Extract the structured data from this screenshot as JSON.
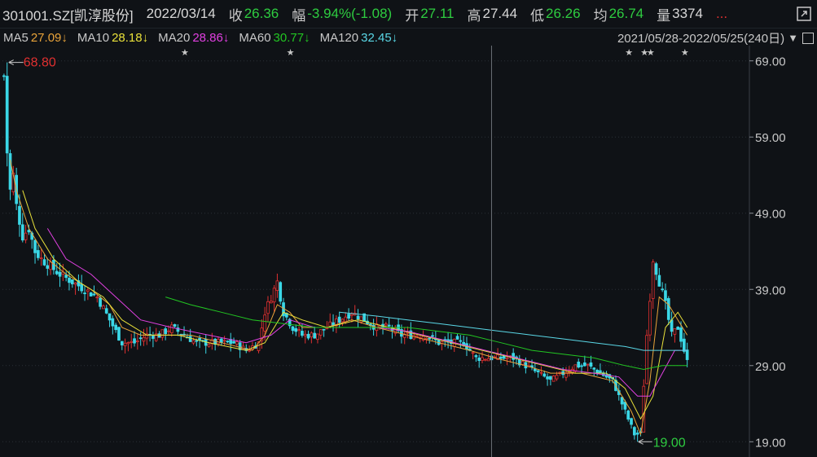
{
  "header": {
    "code": "301001.SZ[凯淳股份]",
    "date": "2022/03/14",
    "close_label": "收",
    "close_value": "26.36",
    "change_label": "幅",
    "change_value": "-3.94%(-1.08)",
    "open_label": "开",
    "open_value": "27.11",
    "high_label": "高",
    "high_value": "27.44",
    "low_label": "低",
    "low_value": "26.26",
    "avg_label": "均",
    "avg_value": "26.74",
    "volume_label": "量",
    "volume_value": "3374",
    "more_label": "..."
  },
  "ma_bar": {
    "items": [
      {
        "label": "MA5",
        "value": "27.09↓",
        "color": "#e8a33a"
      },
      {
        "label": "MA10",
        "value": "28.18↓",
        "color": "#e8e03a"
      },
      {
        "label": "MA20",
        "value": "28.86↓",
        "color": "#e040e0"
      },
      {
        "label": "MA60",
        "value": "30.77↓",
        "color": "#22c522"
      },
      {
        "label": "MA120",
        "value": "32.45↓",
        "color": "#5ad7e6"
      }
    ],
    "range": "2021/05/28-2022/05/25(240日)"
  },
  "colors": {
    "up": "#e03030",
    "down": "#3ad7e6",
    "bg": "#0f1216",
    "grid": "#2a2f36"
  },
  "chart_data": {
    "type": "candlestick",
    "ylim": [
      17,
      71
    ],
    "yticks": [
      "69.00",
      "59.00",
      "49.00",
      "39.00",
      "29.00",
      "19.00"
    ],
    "x_range": "2021/05/28-2022/05/25",
    "n_bars": 240,
    "annotations": {
      "max_label": "68.80",
      "min_label": "19.00"
    },
    "event_markers": 6,
    "cursor_bar": 157,
    "close_path": [
      [
        0,
        67
      ],
      [
        1,
        57
      ],
      [
        2,
        52
      ],
      [
        3,
        54
      ],
      [
        4,
        50
      ],
      [
        6,
        46
      ],
      [
        8,
        47
      ],
      [
        10,
        44
      ],
      [
        12,
        43
      ],
      [
        15,
        42
      ],
      [
        18,
        41
      ],
      [
        22,
        40
      ],
      [
        26,
        39
      ],
      [
        30,
        38
      ],
      [
        34,
        35
      ],
      [
        38,
        32
      ],
      [
        42,
        32
      ],
      [
        46,
        33
      ],
      [
        50,
        33
      ],
      [
        54,
        34
      ],
      [
        58,
        33
      ],
      [
        62,
        32
      ],
      [
        66,
        32
      ],
      [
        70,
        32
      ],
      [
        74,
        32
      ],
      [
        78,
        31
      ],
      [
        82,
        32
      ],
      [
        84,
        36
      ],
      [
        86,
        38
      ],
      [
        88,
        40
      ],
      [
        90,
        36
      ],
      [
        93,
        34
      ],
      [
        96,
        33
      ],
      [
        100,
        33
      ],
      [
        104,
        34
      ],
      [
        108,
        35
      ],
      [
        112,
        36
      ],
      [
        116,
        35
      ],
      [
        120,
        34
      ],
      [
        124,
        34
      ],
      [
        128,
        33
      ],
      [
        132,
        33
      ],
      [
        136,
        33
      ],
      [
        140,
        32
      ],
      [
        144,
        32
      ],
      [
        148,
        32
      ],
      [
        152,
        30
      ],
      [
        156,
        30
      ],
      [
        160,
        30
      ],
      [
        164,
        30
      ],
      [
        168,
        29
      ],
      [
        172,
        28
      ],
      [
        176,
        27
      ],
      [
        180,
        28
      ],
      [
        184,
        29
      ],
      [
        188,
        29
      ],
      [
        192,
        28
      ],
      [
        196,
        27
      ],
      [
        200,
        23
      ],
      [
        203,
        20
      ],
      [
        205,
        20
      ],
      [
        207,
        33
      ],
      [
        209,
        43
      ],
      [
        211,
        40
      ],
      [
        213,
        37
      ],
      [
        215,
        33
      ],
      [
        217,
        34
      ],
      [
        219,
        31
      ],
      [
        220,
        29.5
      ]
    ],
    "series": [
      {
        "name": "MA5",
        "values": [
          [
            2,
            56
          ],
          [
            4,
            52
          ],
          [
            8,
            47
          ],
          [
            14,
            43
          ],
          [
            20,
            41
          ],
          [
            28,
            39
          ],
          [
            34,
            37
          ],
          [
            38,
            34
          ],
          [
            44,
            33
          ],
          [
            52,
            33
          ],
          [
            60,
            33
          ],
          [
            70,
            32
          ],
          [
            80,
            31
          ],
          [
            84,
            33
          ],
          [
            88,
            37
          ],
          [
            92,
            36
          ],
          [
            96,
            34
          ],
          [
            104,
            34
          ],
          [
            112,
            35
          ],
          [
            120,
            34
          ],
          [
            130,
            33
          ],
          [
            140,
            32
          ],
          [
            150,
            31
          ],
          [
            158,
            30
          ],
          [
            168,
            29
          ],
          [
            176,
            28
          ],
          [
            186,
            28
          ],
          [
            196,
            27
          ],
          [
            202,
            23
          ],
          [
            205,
            20
          ],
          [
            208,
            27
          ],
          [
            211,
            38
          ],
          [
            214,
            37
          ],
          [
            217,
            35
          ],
          [
            220,
            33
          ]
        ]
      },
      {
        "name": "MA10",
        "values": [
          [
            6,
            52
          ],
          [
            10,
            47
          ],
          [
            16,
            43
          ],
          [
            24,
            40
          ],
          [
            32,
            38
          ],
          [
            38,
            35
          ],
          [
            46,
            33
          ],
          [
            56,
            33
          ],
          [
            66,
            32
          ],
          [
            78,
            31
          ],
          [
            84,
            32
          ],
          [
            90,
            36
          ],
          [
            96,
            35
          ],
          [
            104,
            34
          ],
          [
            114,
            35
          ],
          [
            124,
            34
          ],
          [
            134,
            33
          ],
          [
            144,
            32
          ],
          [
            154,
            31
          ],
          [
            164,
            30
          ],
          [
            174,
            29
          ],
          [
            184,
            28
          ],
          [
            194,
            28
          ],
          [
            200,
            26
          ],
          [
            205,
            22
          ],
          [
            209,
            25
          ],
          [
            213,
            34
          ],
          [
            217,
            36
          ],
          [
            220,
            34
          ]
        ]
      },
      {
        "name": "MA20",
        "values": [
          [
            14,
            47
          ],
          [
            20,
            43
          ],
          [
            28,
            41
          ],
          [
            36,
            38
          ],
          [
            44,
            35
          ],
          [
            54,
            34
          ],
          [
            66,
            33
          ],
          [
            78,
            32
          ],
          [
            86,
            33
          ],
          [
            92,
            35
          ],
          [
            100,
            34
          ],
          [
            110,
            34
          ],
          [
            120,
            34
          ],
          [
            130,
            33.5
          ],
          [
            140,
            32.5
          ],
          [
            150,
            31.5
          ],
          [
            160,
            30.5
          ],
          [
            170,
            29.5
          ],
          [
            180,
            28.5
          ],
          [
            190,
            28
          ],
          [
            198,
            27.5
          ],
          [
            204,
            25
          ],
          [
            208,
            25
          ],
          [
            212,
            28
          ],
          [
            216,
            31
          ],
          [
            220,
            31
          ]
        ]
      },
      {
        "name": "MA60",
        "values": [
          [
            52,
            38
          ],
          [
            60,
            37
          ],
          [
            70,
            36
          ],
          [
            80,
            35
          ],
          [
            90,
            34.5
          ],
          [
            100,
            34
          ],
          [
            110,
            34
          ],
          [
            120,
            34
          ],
          [
            130,
            34
          ],
          [
            140,
            33.5
          ],
          [
            150,
            33
          ],
          [
            160,
            32
          ],
          [
            170,
            31
          ],
          [
            180,
            30.5
          ],
          [
            190,
            30
          ],
          [
            200,
            29
          ],
          [
            206,
            28.5
          ],
          [
            212,
            29
          ],
          [
            220,
            29
          ]
        ]
      },
      {
        "name": "MA120",
        "values": [
          [
            108,
            36
          ],
          [
            120,
            35.5
          ],
          [
            130,
            35
          ],
          [
            140,
            34.5
          ],
          [
            150,
            34
          ],
          [
            160,
            33.5
          ],
          [
            170,
            33
          ],
          [
            180,
            32.5
          ],
          [
            190,
            32
          ],
          [
            200,
            31.5
          ],
          [
            206,
            31
          ],
          [
            212,
            31
          ],
          [
            220,
            31
          ]
        ]
      }
    ]
  }
}
